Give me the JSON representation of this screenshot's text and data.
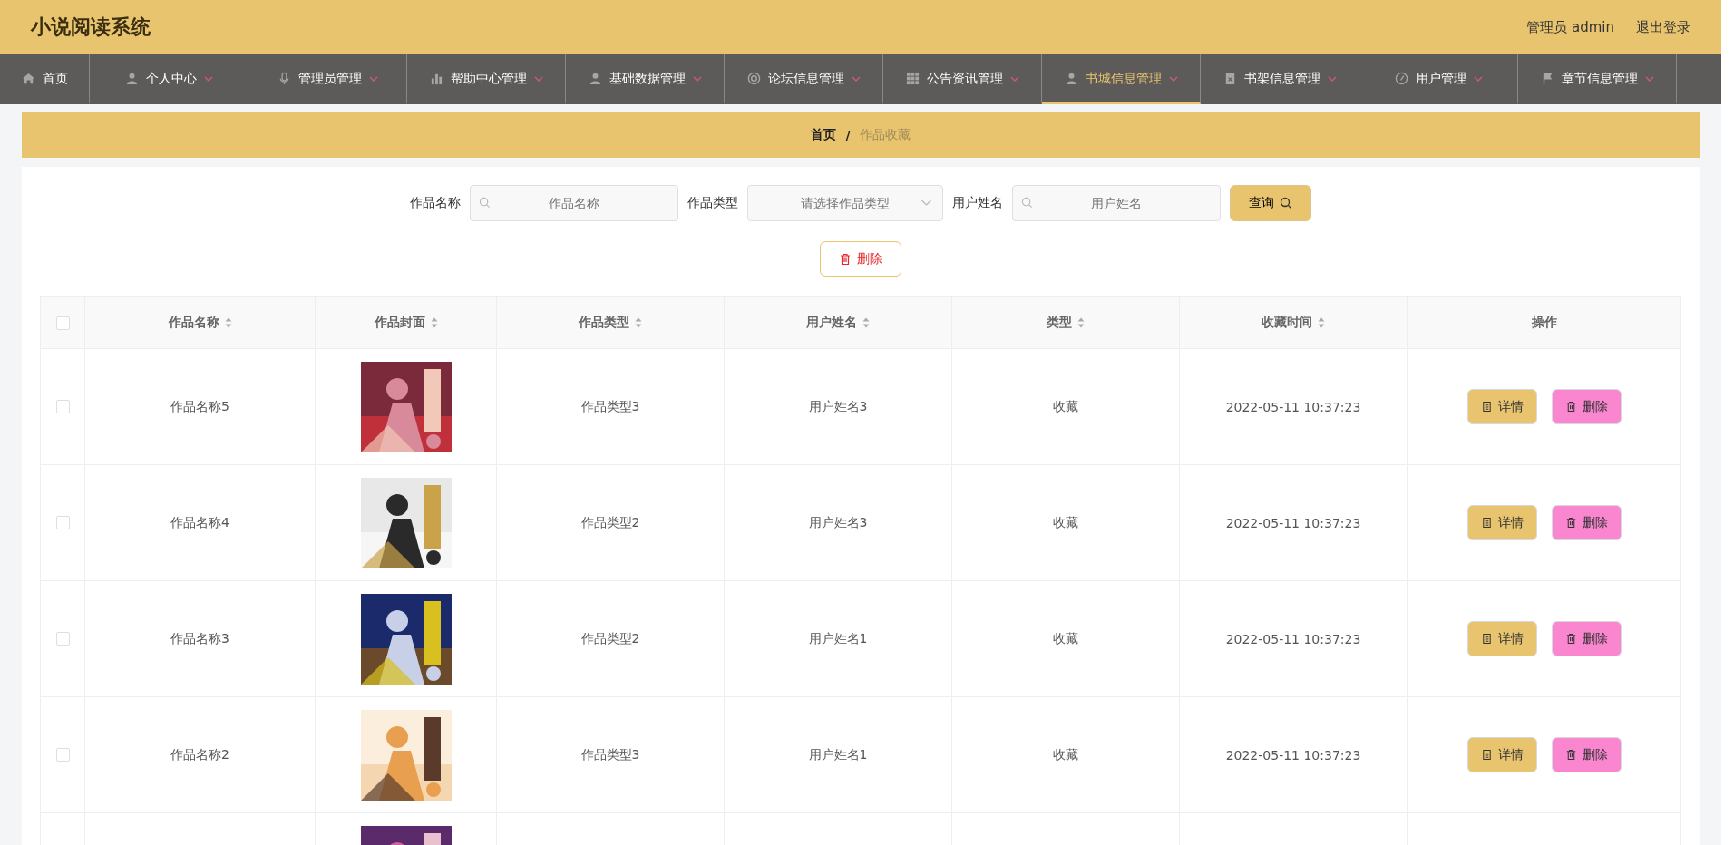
{
  "header": {
    "title": "小说阅读系统",
    "user": "管理员 admin",
    "logout": "退出登录"
  },
  "nav": [
    {
      "label": "首页",
      "dropdown": false,
      "selected": false
    },
    {
      "label": "个人中心",
      "dropdown": true,
      "selected": false
    },
    {
      "label": "管理员管理",
      "dropdown": true,
      "selected": false
    },
    {
      "label": "帮助中心管理",
      "dropdown": true,
      "selected": false
    },
    {
      "label": "基础数据管理",
      "dropdown": true,
      "selected": false
    },
    {
      "label": "论坛信息管理",
      "dropdown": true,
      "selected": false
    },
    {
      "label": "公告资讯管理",
      "dropdown": true,
      "selected": false
    },
    {
      "label": "书城信息管理",
      "dropdown": true,
      "selected": true
    },
    {
      "label": "书架信息管理",
      "dropdown": true,
      "selected": false
    },
    {
      "label": "用户管理",
      "dropdown": true,
      "selected": false
    },
    {
      "label": "章节信息管理",
      "dropdown": true,
      "selected": false
    }
  ],
  "breadcrumb": {
    "items": [
      "首页",
      "作品收藏"
    ],
    "separator": "/"
  },
  "filters": [
    {
      "label": "作品名称",
      "kind": "search",
      "placeholder": "作品名称"
    },
    {
      "label": "作品类型",
      "kind": "select",
      "placeholder": "请选择作品类型"
    },
    {
      "label": "用户姓名",
      "kind": "search",
      "placeholder": "用户姓名"
    }
  ],
  "query_button": "查询",
  "delete_button": "删除",
  "table": {
    "select_all_checked": false,
    "columns": [
      {
        "label": "作品名称",
        "sortable": true
      },
      {
        "label": "作品封面",
        "sortable": true
      },
      {
        "label": "作品类型",
        "sortable": true
      },
      {
        "label": "用户姓名",
        "sortable": true
      },
      {
        "label": "类型",
        "sortable": true
      },
      {
        "label": "收藏时间",
        "sortable": true
      },
      {
        "label": "操作",
        "sortable": false
      }
    ],
    "rows": [
      {
        "checked": false,
        "name": "作品名称5",
        "cover": {
          "kind": "picture"
        },
        "type": "作品类型3",
        "user": "用户姓名3",
        "category": "收藏",
        "time": "2022-05-11 10:37:23",
        "actions": [
          "详情",
          "删除"
        ]
      },
      {
        "checked": false,
        "name": "作品名称4",
        "cover": {
          "kind": "picture"
        },
        "type": "作品类型2",
        "user": "用户姓名3",
        "category": "收藏",
        "time": "2022-05-11 10:37:23",
        "actions": [
          "详情",
          "删除"
        ]
      },
      {
        "checked": false,
        "name": "作品名称3",
        "cover": {
          "kind": "picture"
        },
        "type": "作品类型2",
        "user": "用户姓名1",
        "category": "收藏",
        "time": "2022-05-11 10:37:23",
        "actions": [
          "详情",
          "删除"
        ]
      },
      {
        "checked": false,
        "name": "作品名称2",
        "cover": {
          "kind": "picture"
        },
        "type": "作品类型3",
        "user": "用户姓名1",
        "category": "收藏",
        "time": "2022-05-11 10:37:23",
        "actions": [
          "详情",
          "删除"
        ]
      },
      {
        "cover": {
          "kind": "picture"
        }
      }
    ]
  }
}
